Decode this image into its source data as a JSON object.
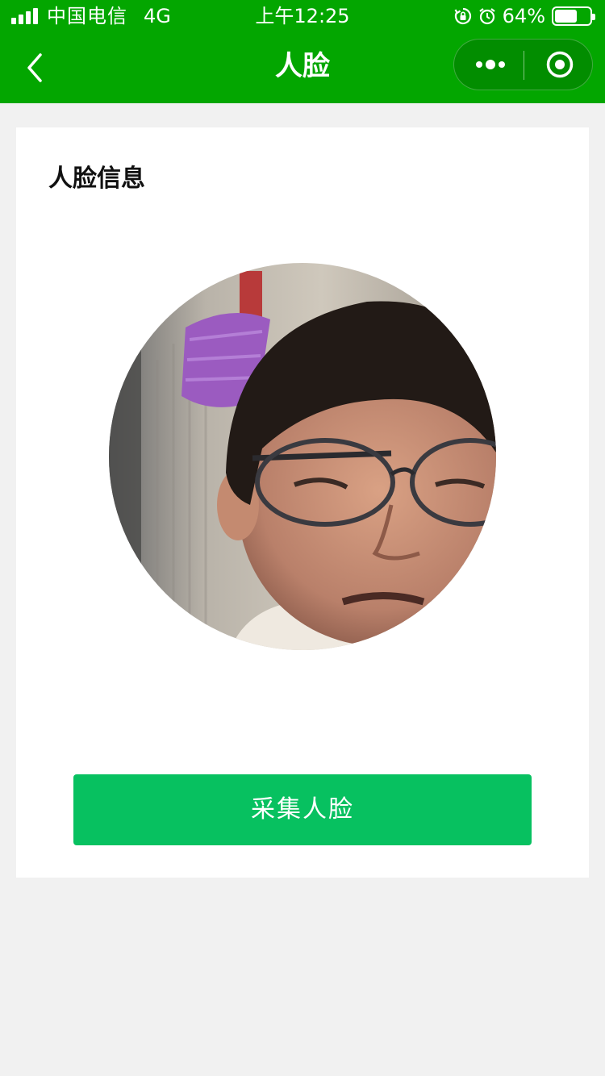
{
  "status_bar": {
    "carrier": "中国电信",
    "network": "4G",
    "time": "上午12:25",
    "battery_percent": "64%",
    "battery_level": 0.64
  },
  "nav": {
    "title": "人脸",
    "back_icon": "chevron-left-icon",
    "more_icon": "more-dots-icon",
    "close_icon": "target-close-icon"
  },
  "card": {
    "title": "人脸信息"
  },
  "capture_button": {
    "label": "采集人脸"
  },
  "colors": {
    "nav_background": "#03a600",
    "button_background": "#07c160",
    "page_background": "#f1f1f1"
  }
}
